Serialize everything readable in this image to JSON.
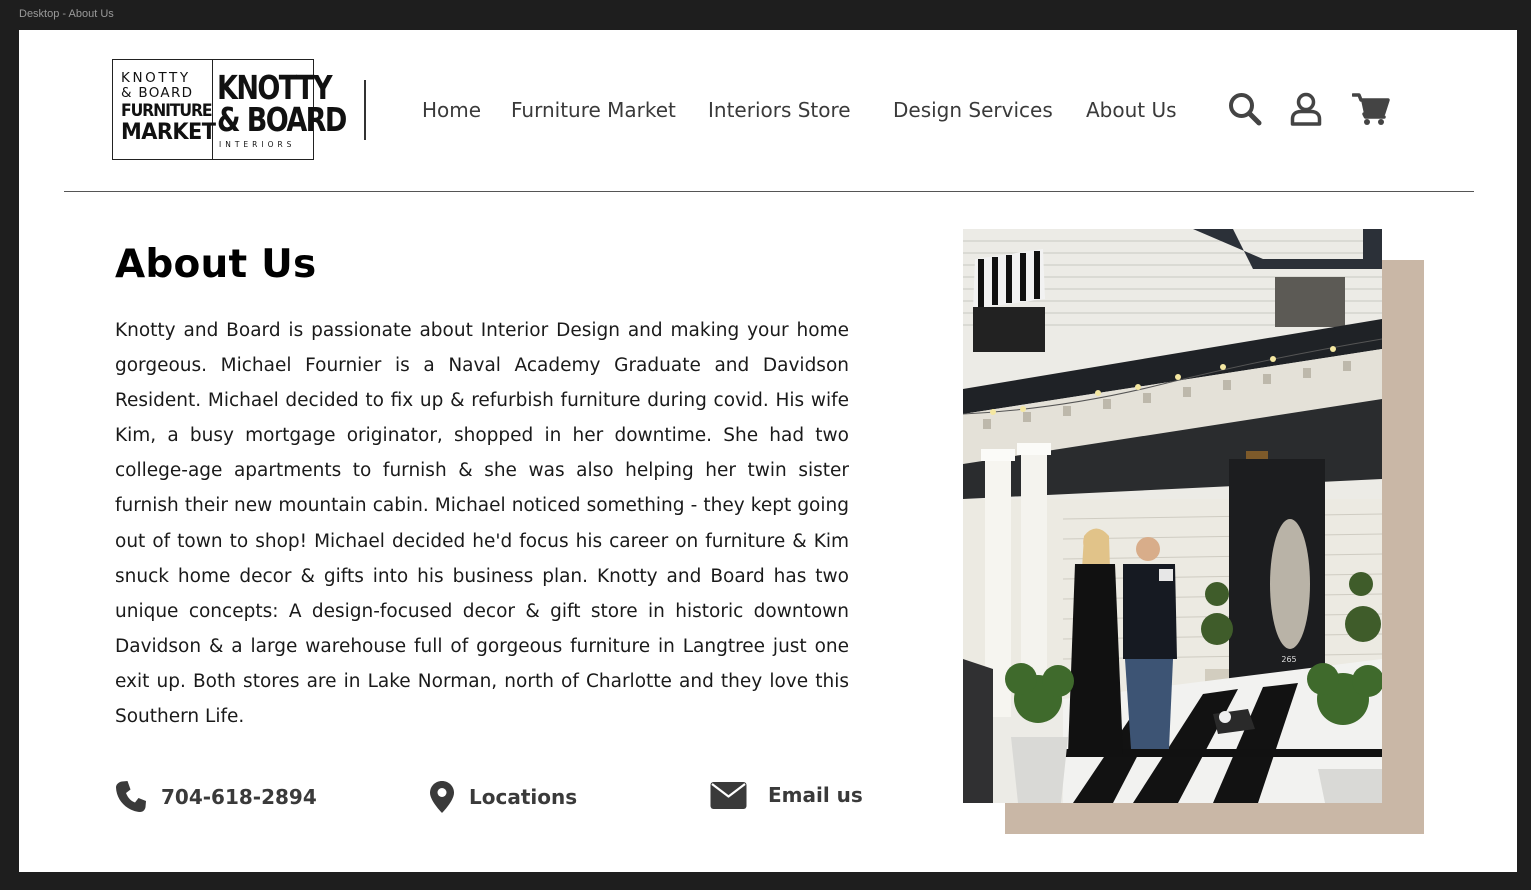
{
  "frame_label": "Desktop - About Us",
  "logo": {
    "left_line1": "KNOTTY",
    "left_line2": "& BOARD",
    "left_line3": "FURNITURE",
    "left_line4": "MARKET",
    "right_line1": "KNOTTY",
    "right_line2": "& BOARD",
    "right_line3": "INTERIORS"
  },
  "nav": {
    "items": [
      {
        "label": "Home"
      },
      {
        "label": "Furniture Market"
      },
      {
        "label": "Interiors Store"
      },
      {
        "label": "Design Services"
      },
      {
        "label": "About Us"
      }
    ]
  },
  "header_icons": [
    "search-icon",
    "user-icon",
    "cart-icon"
  ],
  "main": {
    "title": "About Us",
    "body": "Knotty and Board is passionate about Interior Design and making your home gorgeous. Michael Fournier is a Naval Academy Graduate and Davidson Resident. Michael decided to fix up & refurbish furniture during covid. His wife Kim, a busy mortgage originator, shopped in her downtime. She had two college-age apartments to furnish & she was also helping her twin sister furnish their new mountain cabin. Michael noticed something - they kept going out of town to shop! Michael decided he'd focus his career on furniture & Kim snuck home decor & gifts into his business plan.  Knotty and Board has two unique concepts:  A design-focused decor & gift store in historic downtown Davidson & a large warehouse full of gorgeous furniture in Langtree just one exit up.  Both stores are in Lake Norman, north of Charlotte and they love this Southern Life."
  },
  "contact": {
    "phone": "704-618-2894",
    "locations": "Locations",
    "email": "Email us"
  },
  "photo": {
    "door_number": "265"
  },
  "colors": {
    "frame_bg": "#1e1e1e",
    "page_bg": "#ffffff",
    "nav_text": "#3a3a3a",
    "photo_shadow": "#c9b7a6"
  }
}
